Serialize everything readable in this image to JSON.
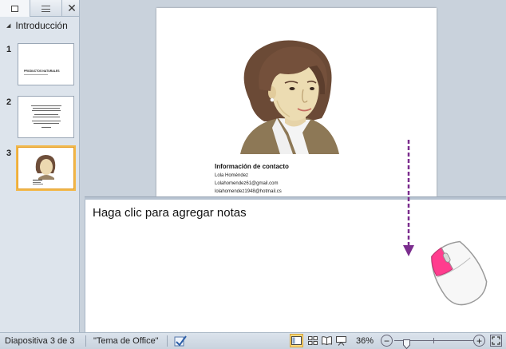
{
  "panel": {
    "close_glyph": "✕",
    "section": {
      "arrow": "◢",
      "label": "Introducción"
    },
    "thumbnails": [
      {
        "number": "1",
        "title": "PRODUCTOS NATURALES"
      },
      {
        "number": "2"
      },
      {
        "number": "3"
      }
    ]
  },
  "slide": {
    "contact_title": "Información de contacto",
    "contact_lines": [
      "Lola Homéndez",
      "Lolahomendez61@gmail.com",
      "lolahomendez1948@hotmail.cs"
    ]
  },
  "notes": {
    "placeholder": "Haga clic para agregar notas"
  },
  "colors": {
    "accent_arrow": "#7b2d8e",
    "mouse_button": "#ff3d8e",
    "selected_view": "#fbd97a"
  },
  "status_bar": {
    "slide_count": "Diapositiva 3 de 3",
    "theme": "\"Tema de Office\"",
    "zoom": "36%",
    "zoom_level_percent": 36,
    "zoom_out_glyph": "−",
    "zoom_in_glyph": "+"
  }
}
